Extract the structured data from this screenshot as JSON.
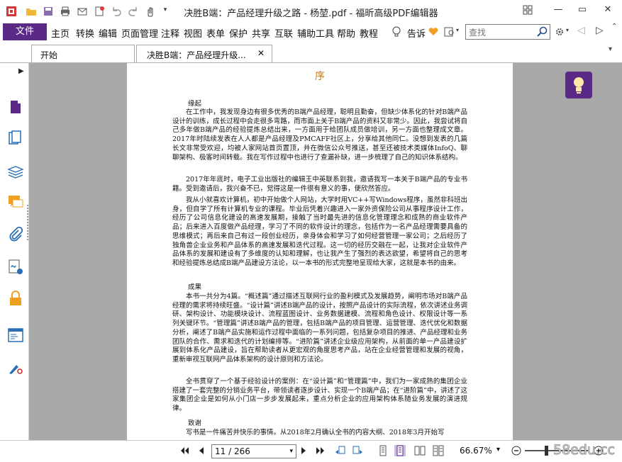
{
  "window": {
    "title": "决胜B端：产品经理升级之路 - 杨堃.pdf - 福昕高级PDF编辑器"
  },
  "menu": {
    "file_label": "文件",
    "items": [
      "主页",
      "转换",
      "编辑",
      "页面管理",
      "注释",
      "视图",
      "表单",
      "保护",
      "共享",
      "互联",
      "辅助工具",
      "帮助",
      "教程"
    ],
    "tell_me": "告诉",
    "search_placeholder": "查找"
  },
  "tabs": [
    {
      "label": "开始"
    },
    {
      "label": "决胜B端：产品经理升级..."
    }
  ],
  "document": {
    "heading": "序",
    "sections": [
      {
        "title": "缘起"
      },
      {
        "title": "成果"
      },
      {
        "title": "致谢"
      }
    ],
    "paragraphs": [
      "在工作中，我发现身边有很多优秀的B端产品经理，聪明且勤奋，但缺少体系化的针对B端产品设计的训练，成长过程中会走很多弯路，而市面上关于B端产品的资料又非常少。因此，我尝试将自己多年做B端产品的经验提炼总结出来，一方面用于给团队成员做培训，另一方面也整理成文章。2017年时陆续发表在人人都是产品经理及PMCAFF社区上，分享给其他同仁。没想到发表的几篇长文非常受欢迎，均被人家网站首页置顶，并在微信公众号推送，甚至还被技术类媒体InfoQ、聊聊架构、极客时间转载。我在写作过程中也进行了查漏补缺，进一步梳理了自己的知识体系结构。",
      "2017年年底时，电子工业出版社的编辑王中英联系到我，邀请我写一本关于B端产品的专业书籍。受到邀请后，我兴奋不已，觉得这是一件很有意义的事，便欣然答应。",
      "我从小就喜欢计算机，初中开始做个人网站，大学时用VC++写Windows程序，虽然非科班出身，但自学了所有计算机专业的课程。毕业后凭着兴趣进入一家外资保险公司从事程序设计工作，经历了公司信息化建设的高速发展期，接触了当时最先进的信息化管理理念和成熟的商业软件产品；后来进入百度做产品经理，学习了不同的软件设计的理念，包括作为一名产品经理需要具备的思维模式；再后来自己有过一段创业经历，亲身体会和学习了如何经营管理一家公司；之后经历了独角兽企业业务和产品体系的高速发展和迭代过程。这一切的经历交融在一起，让我对企业软件产品体系的发展和建设有了多维度的认知和理解，也让我产生了强烈的表达欲望，希望将自己的思考和经验提炼总结成B端产品建设方法论，以一本书的形式完整地呈现给大家，这就是本书的由来。",
      "本书一共分为4篇。“概述篇”通过描述互联网行业的盈利模式及发展趋势，阐明市场对B端产品经理的需求将持续旺盛。“设计篇”讲述B端产品的设计，按照产品设计的实际流程，依次讲述业务调研、架构设计、功能模块设计、流程蓝图设计、业务数据建模、流程和角色设计、权限设计等一系列关键环节。“管理篇”讲述B端产品的管理，包括B端产品的项目管理、运营管理、迭代优化和数据分析，阐述了B端产品实施和运作过程中面临的一系列问题，包括复杂项目的推进、产品经理和业务团队的合作、需求和迭代的计划编排等。“进阶篇”讲述企业级应用架构，从前面的单一产品建设扩展到体系化产品建设，旨在帮助读者从更宏观的角度思考产品，站在企业经营管理和发展的视角，重新审视互联网产品体系架构的设计原则和方法论。",
      "全书贯穿了一个基于经验设计的案例：在“设计篇”和“管理篇”中，我们为一家成熟的集团企业搭建了一套完整的分销业务平台，带领读者逐步设计、实现一个B端产品；在“进阶篇”中，讲述了这家集团企业是如何从小门店一步步发展起来，重点分析企业的应用架构体系随业务发展的演进规律。",
      "写书是一件痛苦并快乐的事情。从2018年2月确认全书的内容大纲、2018年3月开始写"
    ]
  },
  "statusbar": {
    "page_display": "11 / 266",
    "zoom": "66.67%",
    "watermark": "58edu.cc"
  },
  "colors": {
    "accent": "#5b2a86",
    "heading": "#c57b12",
    "workspace": "#a9a9a9"
  }
}
